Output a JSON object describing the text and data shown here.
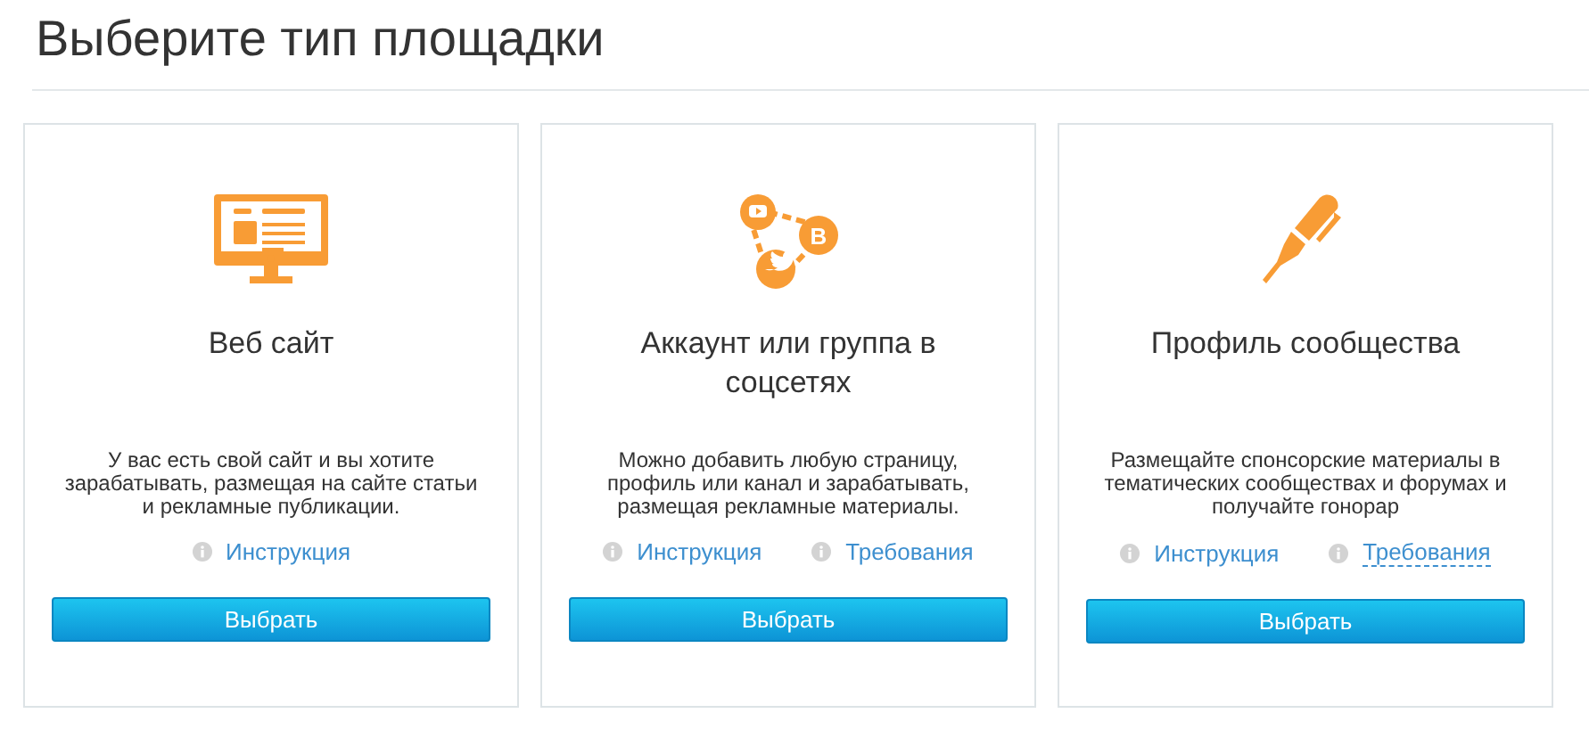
{
  "title": "Выберите тип площадки",
  "cards": [
    {
      "kind": "monitor",
      "title": "Веб сайт",
      "description": "У вас есть свой сайт и вы хотите зарабатывать, размещая на сайте статьи и рекламные публикации.",
      "links": [
        {
          "label": "Инструкция",
          "underlined": false
        }
      ],
      "button": "Выбрать"
    },
    {
      "kind": "social",
      "icon_letter": "B",
      "title": "Аккаунт или группа в соцсетях",
      "description": "Можно добавить любую страницу, профиль или канал и зарабатывать, размещая рекламные материалы.",
      "links": [
        {
          "label": "Инструкция",
          "underlined": false
        },
        {
          "label": "Требования",
          "underlined": false
        }
      ],
      "button": "Выбрать"
    },
    {
      "kind": "pen",
      "title": "Профиль сообщества",
      "description": "Размещайте спонсорские материалы в тематических сообществах и форумах и получайте гонорар",
      "links": [
        {
          "label": "Инструкция",
          "underlined": false
        },
        {
          "label": "Требования",
          "underlined": true
        }
      ],
      "button": "Выбрать"
    }
  ]
}
